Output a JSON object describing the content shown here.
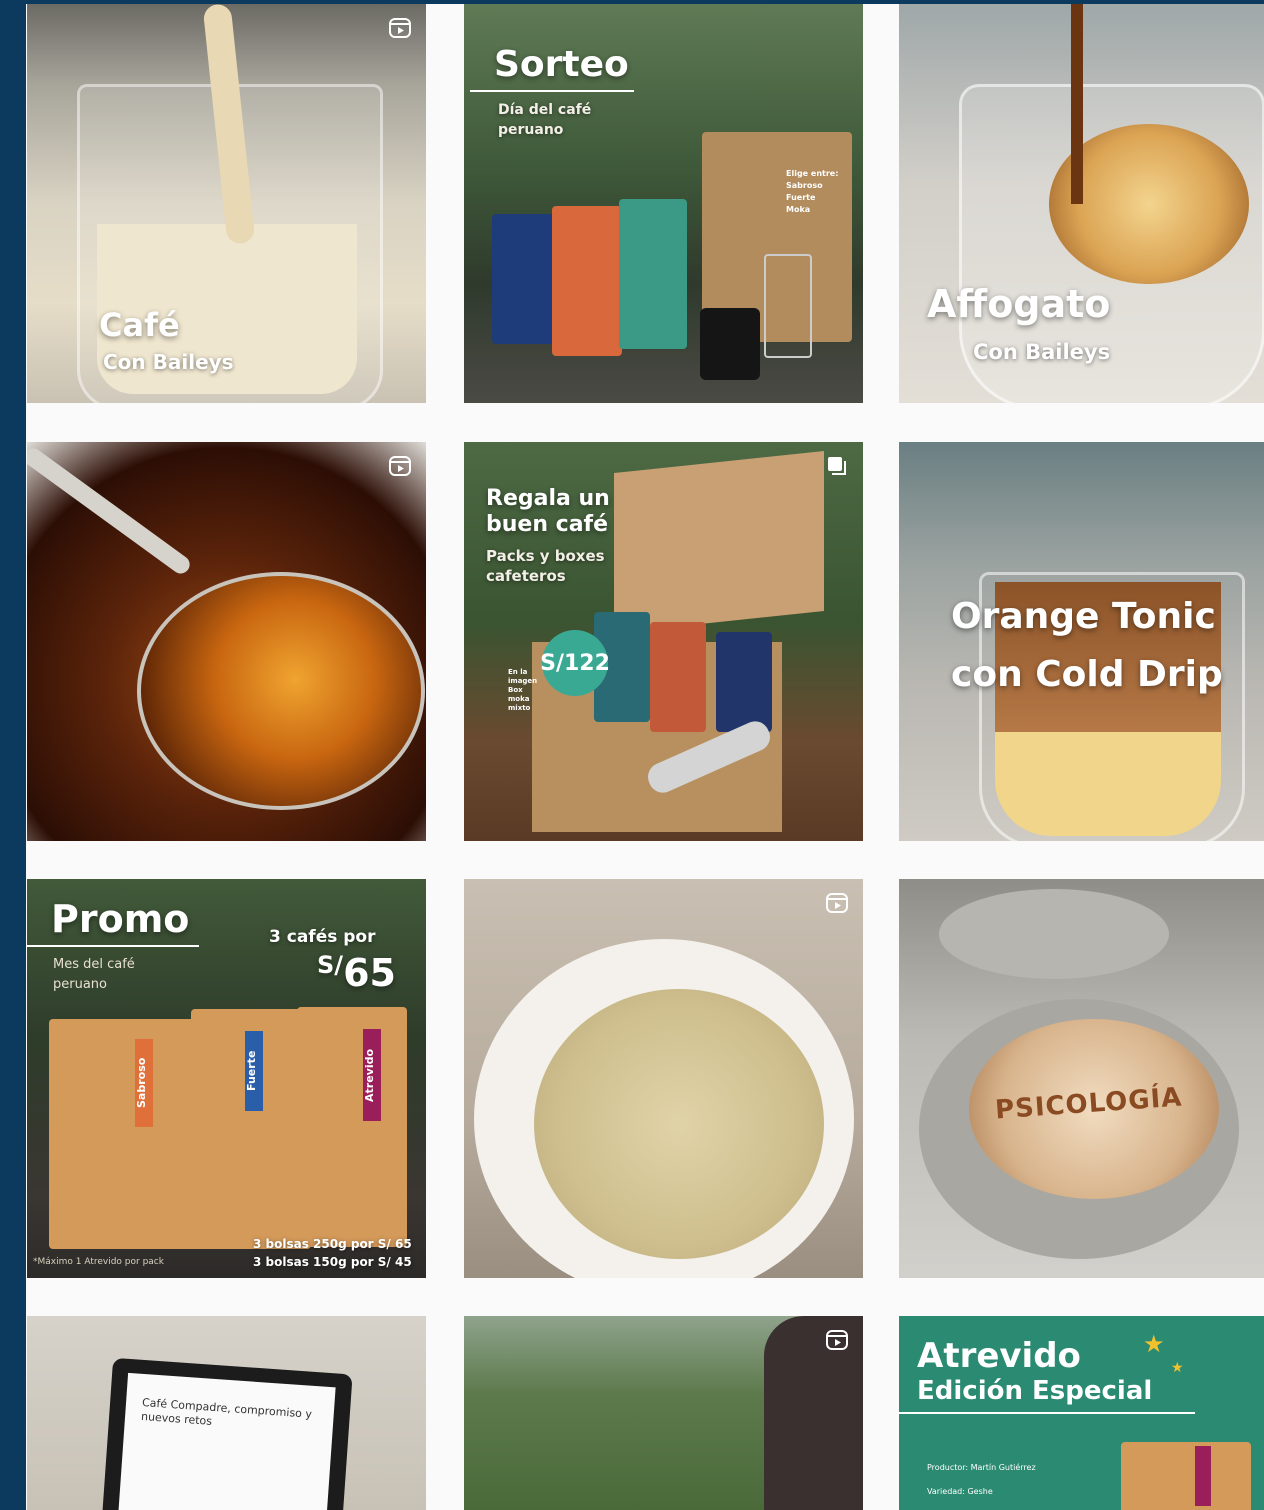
{
  "posts": [
    {
      "title": "Café",
      "subtitle": "Con Baileys",
      "badge": "reel-icon"
    },
    {
      "title": "Sorteo",
      "subtitle": "Día del café peruano",
      "side_text": [
        "Elige entre:",
        "Sabroso",
        "Fuerte",
        "Moka"
      ],
      "badge": ""
    },
    {
      "title": "Affogato",
      "subtitle": "Con Baileys",
      "badge": ""
    },
    {
      "title": "",
      "subtitle": "",
      "badge": "reel-icon"
    },
    {
      "title": "Regala un buen café",
      "subtitle": "Packs y boxes cafeteros",
      "price": "S/122",
      "price_note": "En la imagen Box moka mixto",
      "badge": "carousel-icon"
    },
    {
      "title": "Orange Tonic con Cold Drip",
      "subtitle": "",
      "badge": ""
    },
    {
      "title": "Promo",
      "subtitle": "Mes del café peruano",
      "offer": "3 cafés por",
      "price_currency": "S/",
      "price_value": "65",
      "bag_labels": [
        "Sabroso",
        "Fuerte",
        "Atrevido"
      ],
      "footer_lines": [
        "3 bolsas 250g por S/ 65",
        "3 bolsas 150g por S/ 45"
      ],
      "footnote": "*Máximo 1 Atrevido por pack",
      "badge": ""
    },
    {
      "title": "",
      "subtitle": "",
      "badge": "reel-icon"
    },
    {
      "title": "",
      "subtitle": "",
      "latte_art": "PSICOLOGÍA",
      "badge": ""
    },
    {
      "title": "",
      "subtitle": "",
      "screen_title": "Café Compadre, compromiso y nuevos retos",
      "badge": ""
    },
    {
      "title": "",
      "subtitle": "",
      "badge": "reel-icon"
    },
    {
      "title": "Atrevido",
      "subtitle": "Edición Especial",
      "details": [
        "Productor: Martín Gutiérrez",
        "Variedad: Geshe"
      ],
      "badge": ""
    }
  ],
  "colors": {
    "page_bg": "#0b3a5e",
    "grid_bg": "#fafafa",
    "accent_teal": "#3aa994",
    "atrevido_green": "#2a8a72",
    "star_yellow": "#f2c12e"
  }
}
